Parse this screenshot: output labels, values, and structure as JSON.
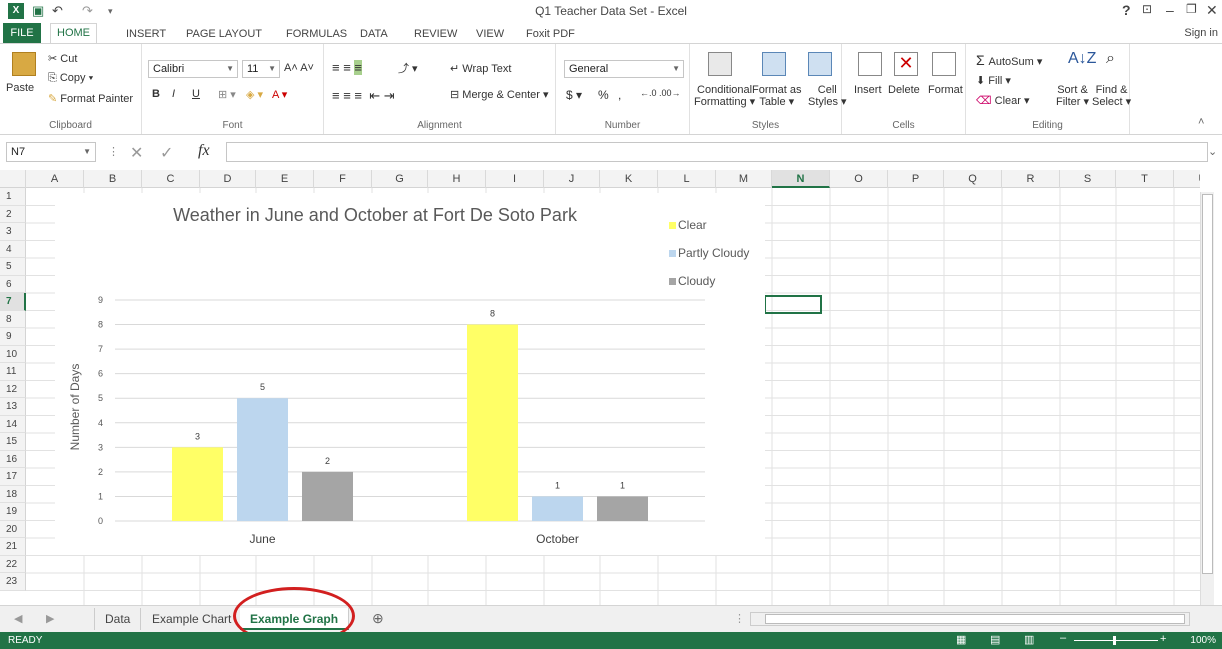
{
  "window": {
    "title": "Q1 Teacher Data Set - Excel",
    "help": "?",
    "sign_in": "Sign in"
  },
  "ribbon_tabs": [
    "FILE",
    "HOME",
    "INSERT",
    "PAGE LAYOUT",
    "FORMULAS",
    "DATA",
    "REVIEW",
    "VIEW",
    "Foxit PDF"
  ],
  "clipboard": {
    "paste": "Paste",
    "cut": "Cut",
    "copy": "Copy",
    "format_painter": "Format Painter",
    "label": "Clipboard"
  },
  "font": {
    "name": "Calibri",
    "size": "11",
    "label": "Font",
    "bold": "B",
    "italic": "I",
    "underline": "U"
  },
  "alignment": {
    "wrap_text": "Wrap Text",
    "merge_center": "Merge & Center",
    "label": "Alignment"
  },
  "number": {
    "format": "General",
    "currency": "$",
    "percent": "%",
    "comma": ",",
    "label": "Number"
  },
  "styles": {
    "conditional_1": "Conditional",
    "conditional_2": "Formatting",
    "format_table_1": "Format as",
    "format_table_2": "Table",
    "cell_styles_1": "Cell",
    "cell_styles_2": "Styles",
    "label": "Styles"
  },
  "cells": {
    "insert": "Insert",
    "delete": "Delete",
    "format": "Format",
    "label": "Cells"
  },
  "editing": {
    "autosum": "AutoSum",
    "fill": "Fill",
    "clear": "Clear",
    "sort_1": "Sort &",
    "sort_2": "Filter",
    "find_1": "Find &",
    "find_2": "Select",
    "label": "Editing"
  },
  "formula": {
    "name_box": "N7",
    "content": ""
  },
  "columns": [
    "A",
    "B",
    "C",
    "D",
    "E",
    "F",
    "G",
    "H",
    "I",
    "J",
    "K",
    "L",
    "M",
    "N",
    "O",
    "P",
    "Q",
    "R",
    "S",
    "T",
    "U"
  ],
  "rows": [
    "1",
    "2",
    "3",
    "4",
    "5",
    "6",
    "7",
    "8",
    "9",
    "10",
    "11",
    "12",
    "13",
    "14",
    "15",
    "16",
    "17",
    "18",
    "19",
    "20",
    "21",
    "22",
    "23"
  ],
  "selected": {
    "column": "N",
    "row": "7"
  },
  "sheets": [
    "Data",
    "Example Chart",
    "Example Graph"
  ],
  "active_sheet": "Example Graph",
  "status": {
    "ready": "READY",
    "zoom": "100%"
  },
  "colors": {
    "excel_green": "#217346",
    "clear": "#ffff66",
    "partly_cloudy": "#bcd6ee",
    "cloudy": "#a5a5a5",
    "annotation": "#d21f1f"
  },
  "chart_data": {
    "type": "bar",
    "title": "Weather in June and October at Fort De Soto Park",
    "categories": [
      "June",
      "October"
    ],
    "series": [
      {
        "name": "Clear",
        "values": [
          3,
          8
        ],
        "color": "#ffff66"
      },
      {
        "name": "Partly Cloudy",
        "values": [
          5,
          1
        ],
        "color": "#bcd6ee"
      },
      {
        "name": "Cloudy",
        "values": [
          2,
          1
        ],
        "color": "#a5a5a5"
      }
    ],
    "ylabel": "Number of Days",
    "xlabel": "",
    "ylim": [
      0,
      9
    ],
    "yticks": [
      "0",
      "1",
      "2",
      "3",
      "4",
      "5",
      "6",
      "7",
      "8",
      "9"
    ],
    "grid": true,
    "legend_position": "right"
  }
}
